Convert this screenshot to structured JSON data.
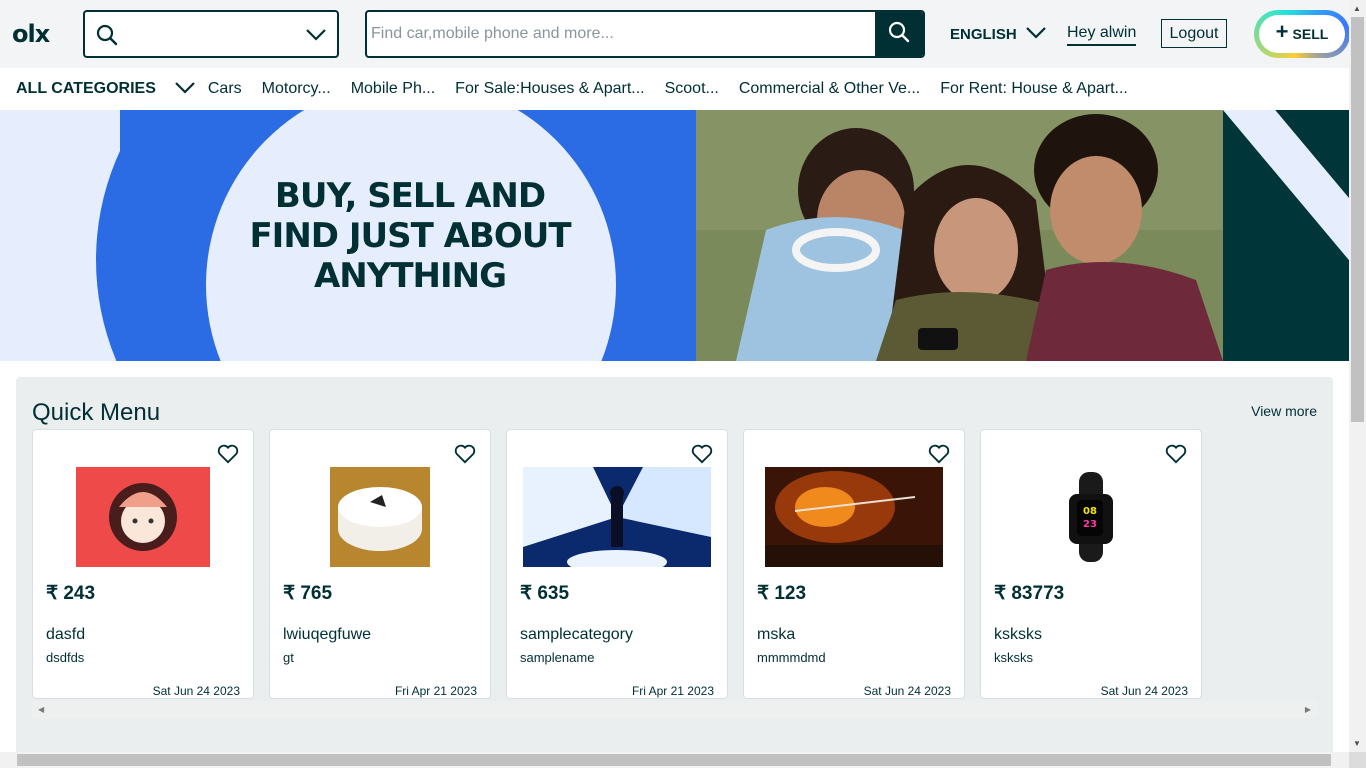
{
  "header": {
    "logo_text": "olx",
    "search_placeholder": "Find car,mobile phone and more...",
    "language": "ENGLISH",
    "greeting": "Hey alwin",
    "logout_label": "Logout",
    "sell_label": "SELL"
  },
  "categories": {
    "all_label": "ALL CATEGORIES",
    "items": [
      "Cars",
      "Motorcy...",
      "Mobile Ph...",
      "For Sale:Houses & Apart...",
      "Scoot...",
      "Commercial & Other Ve...",
      "For Rent: House & Apart..."
    ]
  },
  "banner": {
    "headline_1": "BUY, SELL AND",
    "headline_2": "FIND JUST ABOUT",
    "headline_3": "ANYTHING"
  },
  "quick_menu": {
    "title": "Quick Menu",
    "view_more": "View more",
    "products": [
      {
        "price": "₹ 243",
        "title": "dasfd",
        "sub": "dsdfds",
        "date": "Sat Jun 24 2023",
        "image": "avatar-cartoon"
      },
      {
        "price": "₹ 765",
        "title": "lwiuqegfuwe",
        "sub": "gt",
        "date": "Fri Apr 21 2023",
        "image": "cake"
      },
      {
        "price": "₹ 635",
        "title": "samplecategory",
        "sub": "samplename",
        "date": "Fri Apr 21 2023",
        "image": "anime-art"
      },
      {
        "price": "₹ 123",
        "title": "mska",
        "sub": "mmmmdmd",
        "date": "Sat Jun 24 2023",
        "image": "anime-fire"
      },
      {
        "price": "₹ 83773",
        "title": "ksksks",
        "sub": "ksksks",
        "date": "Sat Jun 24 2023",
        "image": "smartwatch"
      }
    ]
  },
  "colors": {
    "brand": "#002f34",
    "banner_blue": "#2b6be4",
    "banner_pale": "#e6eefd",
    "panel_bg": "#ebeeef"
  }
}
